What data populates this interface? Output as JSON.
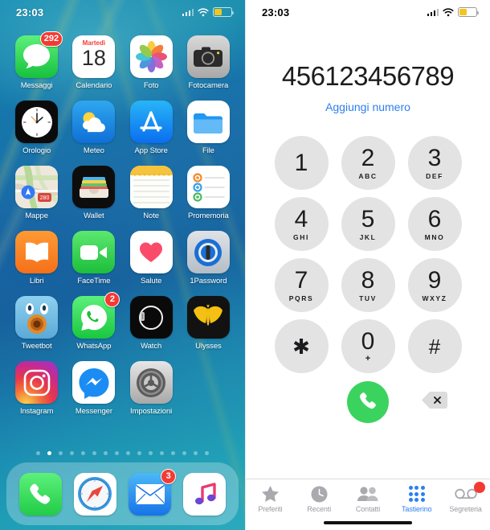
{
  "home": {
    "status": {
      "time": "23:03",
      "battery_percent": 42,
      "battery_color": "#f4c521"
    },
    "apps": [
      {
        "name": "Messaggi",
        "icon": "messages-icon",
        "badge": "292"
      },
      {
        "name": "Calendario",
        "icon": "calendar-icon",
        "day_name": "Martedì",
        "day_number": "18"
      },
      {
        "name": "Foto",
        "icon": "photos-icon"
      },
      {
        "name": "Fotocamera",
        "icon": "camera-icon"
      },
      {
        "name": "Orologio",
        "icon": "clock-icon"
      },
      {
        "name": "Meteo",
        "icon": "weather-icon"
      },
      {
        "name": "App Store",
        "icon": "appstore-icon"
      },
      {
        "name": "File",
        "icon": "files-icon"
      },
      {
        "name": "Mappe",
        "icon": "maps-icon"
      },
      {
        "name": "Wallet",
        "icon": "wallet-icon"
      },
      {
        "name": "Note",
        "icon": "notes-icon"
      },
      {
        "name": "Promemoria",
        "icon": "reminders-icon"
      },
      {
        "name": "Libri",
        "icon": "books-icon"
      },
      {
        "name": "FaceTime",
        "icon": "facetime-icon"
      },
      {
        "name": "Salute",
        "icon": "health-icon"
      },
      {
        "name": "1Password",
        "icon": "onepassword-icon"
      },
      {
        "name": "Tweetbot",
        "icon": "tweetbot-icon"
      },
      {
        "name": "WhatsApp",
        "icon": "whatsapp-icon",
        "badge": "2"
      },
      {
        "name": "Watch",
        "icon": "watch-icon"
      },
      {
        "name": "Ulysses",
        "icon": "ulysses-icon"
      },
      {
        "name": "Instagram",
        "icon": "instagram-icon"
      },
      {
        "name": "Messenger",
        "icon": "messenger-icon"
      },
      {
        "name": "Impostazioni",
        "icon": "settings-icon"
      }
    ],
    "page_dots": {
      "count": 16,
      "active_index": 1
    },
    "dock": [
      {
        "name": "Telefono",
        "icon": "phone-icon"
      },
      {
        "name": "Safari",
        "icon": "safari-icon"
      },
      {
        "name": "Mail",
        "icon": "mail-icon",
        "badge": "3"
      },
      {
        "name": "Musica",
        "icon": "music-icon"
      }
    ]
  },
  "phone": {
    "status": {
      "time": "23:03",
      "battery_percent": 42,
      "battery_color": "#f4c521"
    },
    "dialed_number": "456123456789",
    "add_number_label": "Aggiungi numero",
    "keypad": [
      {
        "digit": "1",
        "letters": ""
      },
      {
        "digit": "2",
        "letters": "ABC"
      },
      {
        "digit": "3",
        "letters": "DEF"
      },
      {
        "digit": "4",
        "letters": "GHI"
      },
      {
        "digit": "5",
        "letters": "JKL"
      },
      {
        "digit": "6",
        "letters": "MNO"
      },
      {
        "digit": "7",
        "letters": "PQRS"
      },
      {
        "digit": "8",
        "letters": "TUV"
      },
      {
        "digit": "9",
        "letters": "WXYZ"
      },
      {
        "digit": "✱",
        "letters": ""
      },
      {
        "digit": "0",
        "letters": "+"
      },
      {
        "digit": "#",
        "letters": ""
      }
    ],
    "call_button": {
      "icon": "phone-handset-icon",
      "color": "#3ad35e"
    },
    "delete_button": {
      "icon": "backspace-icon",
      "glyph": "✕"
    },
    "tabs": [
      {
        "label": "Preferiti",
        "icon": "star-icon",
        "active": false
      },
      {
        "label": "Recenti",
        "icon": "clock-recents-icon",
        "active": false
      },
      {
        "label": "Contatti",
        "icon": "contacts-icon",
        "active": false
      },
      {
        "label": "Tastierino",
        "icon": "keypad-icon",
        "active": true
      },
      {
        "label": "Segreteria",
        "icon": "voicemail-icon",
        "active": false,
        "badge": true
      }
    ],
    "accent_color": "#2d7ff0"
  }
}
